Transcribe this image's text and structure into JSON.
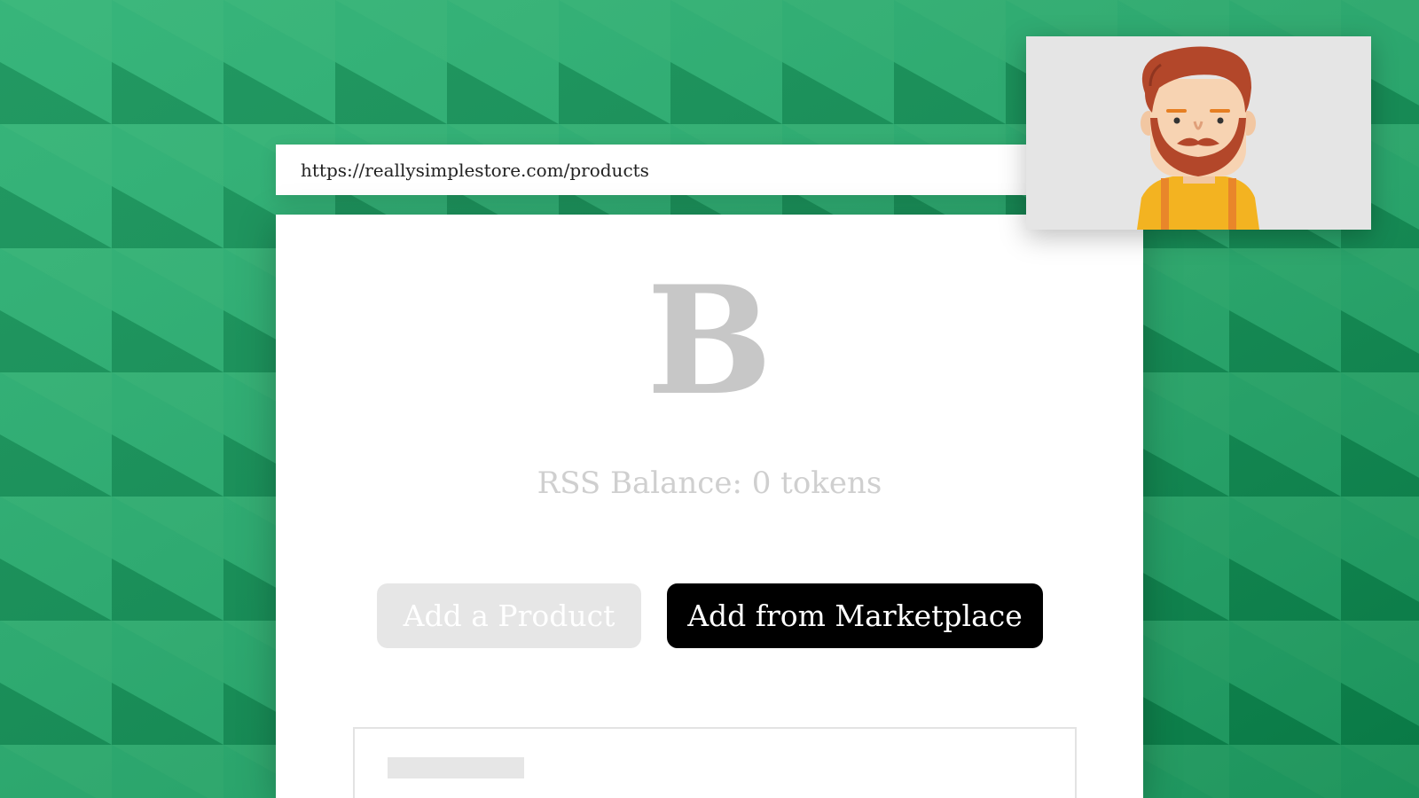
{
  "browser": {
    "url": "https://reallysimplestore.com/products"
  },
  "store": {
    "logo_letter": "B",
    "balance_text": "RSS Balance: 0 tokens"
  },
  "actions": {
    "add_product_label": "Add a Product",
    "add_marketplace_label": "Add from Marketplace"
  },
  "colors": {
    "background_green": "#0d9e5a",
    "primary_button": "#000000",
    "disabled_button": "#e6e6e6"
  },
  "icons": {
    "avatar": "user-avatar-icon"
  }
}
